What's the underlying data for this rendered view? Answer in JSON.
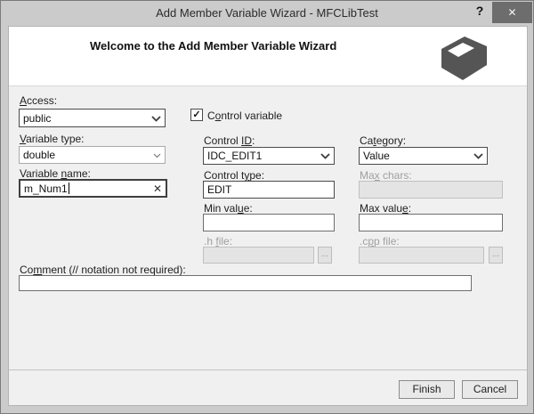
{
  "window": {
    "title": "Add Member Variable Wizard - MFCLibTest",
    "help_glyph": "?",
    "close_glyph": "✕"
  },
  "header": {
    "welcome": "Welcome to the Add Member Variable Wizard",
    "brand_icon": "open-box-3d-icon"
  },
  "form": {
    "access": {
      "label": {
        "pre": "",
        "key": "A",
        "post": "ccess:"
      },
      "value": "public"
    },
    "control_variable": {
      "label": {
        "pre": "C",
        "key": "o",
        "post": "ntrol variable"
      },
      "checked": true,
      "check_glyph": "✓"
    },
    "variable_type": {
      "label": {
        "pre": "",
        "key": "V",
        "post": "ariable type:"
      },
      "value": "double"
    },
    "variable_name": {
      "label": {
        "pre": "Variable ",
        "key": "n",
        "post": "ame:"
      },
      "value": "m_Num1",
      "clear_glyph": "✕"
    },
    "control_id": {
      "label": {
        "pre": "Control ",
        "key": "ID",
        "post": ":"
      },
      "value": "IDC_EDIT1"
    },
    "category": {
      "label": {
        "pre": "Ca",
        "key": "t",
        "post": "egory:"
      },
      "value": "Value"
    },
    "control_type": {
      "label": {
        "pre": "Control t",
        "key": "y",
        "post": "pe:"
      },
      "value": "EDIT"
    },
    "max_chars": {
      "label": {
        "pre": "Ma",
        "key": "x",
        "post": " chars:"
      },
      "value": "",
      "disabled": true
    },
    "min_value": {
      "label": {
        "pre": "Min val",
        "key": "u",
        "post": "e:"
      },
      "value": ""
    },
    "max_value": {
      "label": {
        "pre": "Max valu",
        "key": "e",
        "post": ":"
      },
      "value": ""
    },
    "h_file": {
      "label": {
        "pre": ".h ",
        "key": "f",
        "post": "ile:"
      },
      "value": "",
      "browse_glyph": "...",
      "disabled": true
    },
    "cpp_file": {
      "label": {
        "pre": ".c",
        "key": "p",
        "post": "p file:"
      },
      "value": "",
      "browse_glyph": "...",
      "disabled": true
    },
    "comment": {
      "label": {
        "pre": "Co",
        "key": "m",
        "post": "ment (// notation not required):"
      },
      "value": ""
    }
  },
  "buttons": {
    "finish": "Finish",
    "cancel": "Cancel"
  },
  "colors": {
    "titlebar_bg": "#cbcbcb",
    "panel_bg": "#f0f0f0",
    "header_bg": "#ffffff",
    "close_button_bg": "#6d6d6d",
    "brand_icon": "#555555",
    "disabled_text": "#9f9f9f",
    "disabled_field_bg": "#e4e4e4"
  }
}
